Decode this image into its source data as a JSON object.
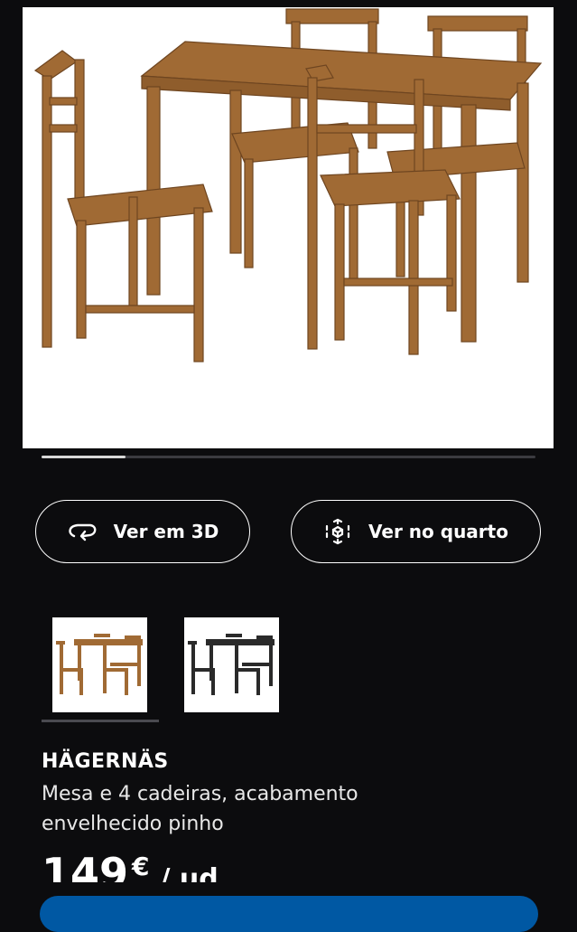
{
  "gallery": {
    "image_alt": "Mesa com 4 cadeiras em pinho envelhecido",
    "progress": 0.17
  },
  "actions": {
    "view_3d": {
      "label": "Ver em 3D",
      "icon": "rotate-3d-icon"
    },
    "view_room": {
      "label": "Ver no quarto",
      "icon": "ar-cube-icon"
    }
  },
  "variants": [
    {
      "color": "#a06a34",
      "selected": true
    },
    {
      "color": "#2a2a2a",
      "selected": false
    }
  ],
  "product": {
    "name": "HÄGERNÄS",
    "description": "Mesa e 4 cadeiras, acabamento envelhecido pinho",
    "price": "149",
    "currency": "€",
    "unit": "/ ud"
  },
  "colors": {
    "background": "#0c0c0e",
    "wood": "#a06a34",
    "cta": "#0058a3"
  }
}
